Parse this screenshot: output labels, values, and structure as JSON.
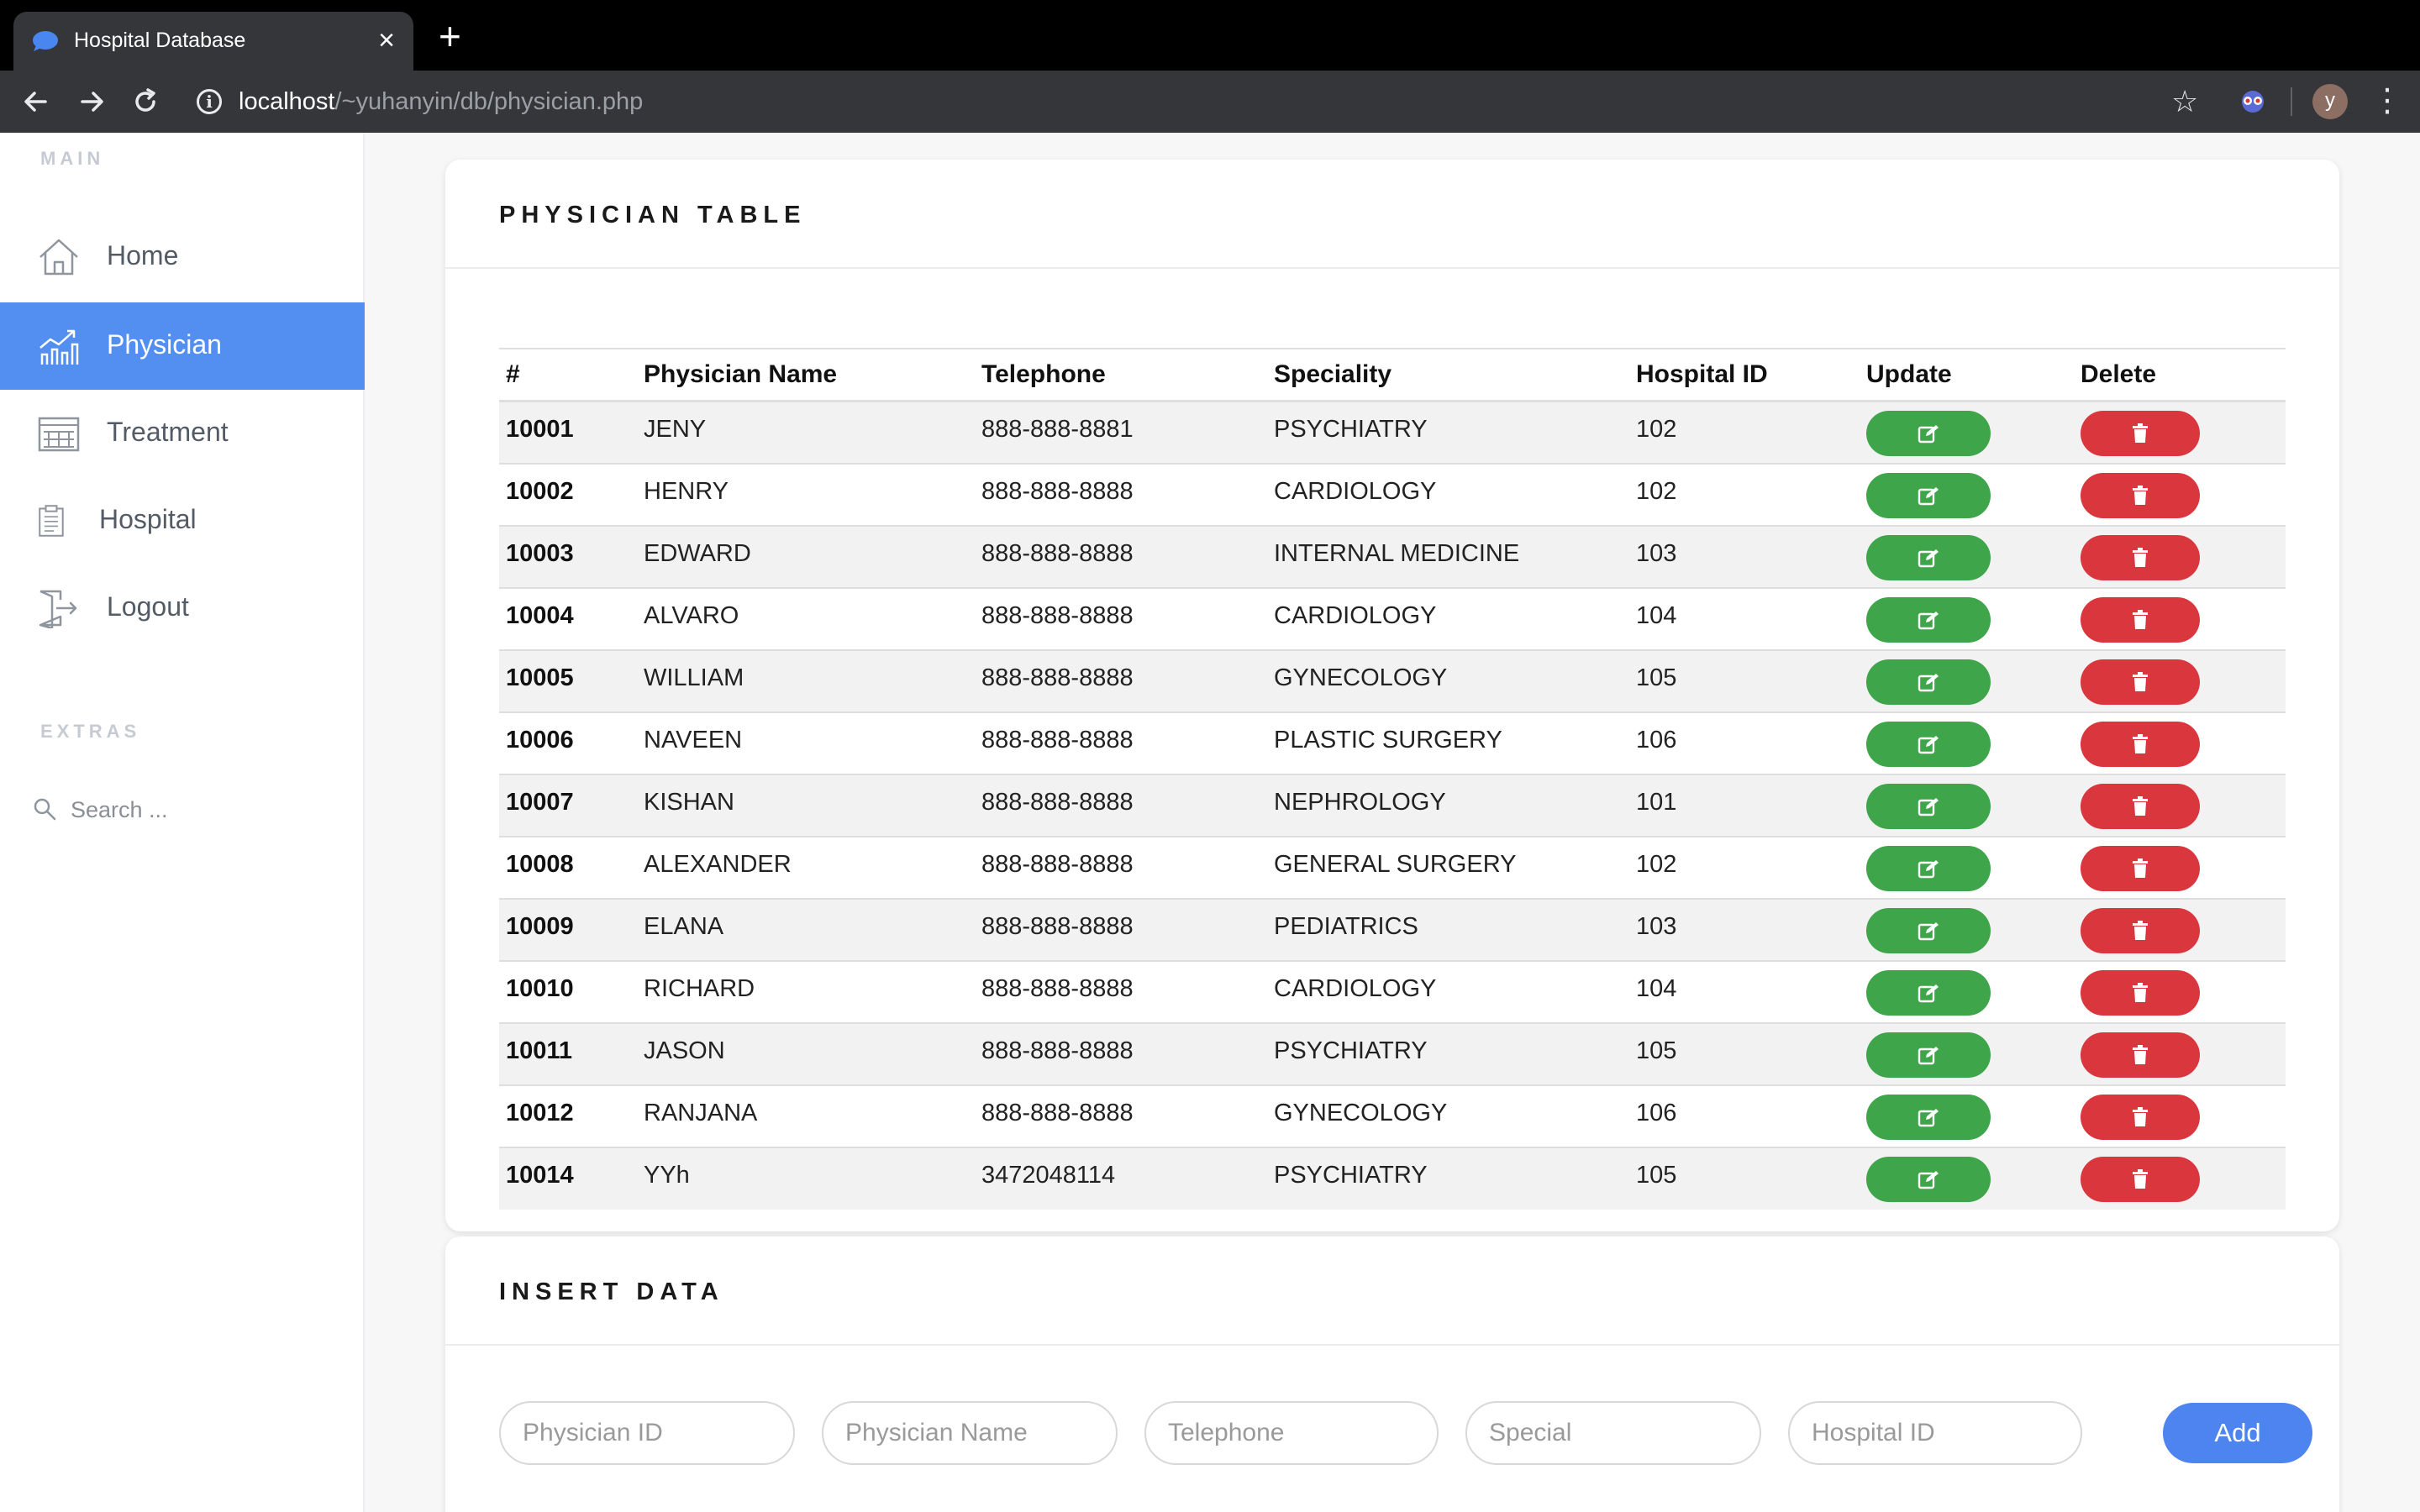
{
  "browser": {
    "tab_title": "Hospital Database",
    "url_host": "localhost",
    "url_path": "/~yuhanyin/db/physician.php",
    "avatar_letter": "y"
  },
  "sidebar": {
    "main_label": "MAIN",
    "extras_label": "EXTRAS",
    "items": [
      {
        "label": "Home",
        "icon": "home-icon"
      },
      {
        "label": "Physician",
        "icon": "chart-icon",
        "active": true
      },
      {
        "label": "Treatment",
        "icon": "calendar-icon"
      },
      {
        "label": "Hospital",
        "icon": "clipboard-icon"
      },
      {
        "label": "Logout",
        "icon": "logout-icon"
      }
    ],
    "search_placeholder": "Search ..."
  },
  "physician_table": {
    "title": "PHYSICIAN TABLE",
    "columns": [
      "#",
      "Physician Name",
      "Telephone",
      "Speciality",
      "Hospital ID",
      "Update",
      "Delete"
    ],
    "rows": [
      {
        "id": "10001",
        "name": "JENY",
        "telephone": "888-888-8881",
        "speciality": "PSYCHIATRY",
        "hospital_id": "102"
      },
      {
        "id": "10002",
        "name": "HENRY",
        "telephone": "888-888-8888",
        "speciality": "CARDIOLOGY",
        "hospital_id": "102"
      },
      {
        "id": "10003",
        "name": "EDWARD",
        "telephone": "888-888-8888",
        "speciality": "INTERNAL MEDICINE",
        "hospital_id": "103"
      },
      {
        "id": "10004",
        "name": "ALVARO",
        "telephone": "888-888-8888",
        "speciality": "CARDIOLOGY",
        "hospital_id": "104"
      },
      {
        "id": "10005",
        "name": "WILLIAM",
        "telephone": "888-888-8888",
        "speciality": "GYNECOLOGY",
        "hospital_id": "105"
      },
      {
        "id": "10006",
        "name": "NAVEEN",
        "telephone": "888-888-8888",
        "speciality": "PLASTIC SURGERY",
        "hospital_id": "106"
      },
      {
        "id": "10007",
        "name": "KISHAN",
        "telephone": "888-888-8888",
        "speciality": "NEPHROLOGY",
        "hospital_id": "101"
      },
      {
        "id": "10008",
        "name": "ALEXANDER",
        "telephone": "888-888-8888",
        "speciality": "GENERAL SURGERY",
        "hospital_id": "102"
      },
      {
        "id": "10009",
        "name": "ELANA",
        "telephone": "888-888-8888",
        "speciality": "PEDIATRICS",
        "hospital_id": "103"
      },
      {
        "id": "10010",
        "name": "RICHARD",
        "telephone": "888-888-8888",
        "speciality": "CARDIOLOGY",
        "hospital_id": "104"
      },
      {
        "id": "10011",
        "name": "JASON",
        "telephone": "888-888-8888",
        "speciality": "PSYCHIATRY",
        "hospital_id": "105"
      },
      {
        "id": "10012",
        "name": "RANJANA",
        "telephone": "888-888-8888",
        "speciality": "GYNECOLOGY",
        "hospital_id": "106"
      },
      {
        "id": "10014",
        "name": "YYh",
        "telephone": "3472048114",
        "speciality": "PSYCHIATRY",
        "hospital_id": "105"
      }
    ],
    "update_icon": "edit-icon",
    "delete_icon": "trash-icon"
  },
  "insert_form": {
    "title": "INSERT DATA",
    "placeholders": {
      "physician_id": "Physician ID",
      "physician_name": "Physician Name",
      "telephone": "Telephone",
      "special": "Special",
      "hospital_id": "Hospital ID"
    },
    "add_label": "Add"
  },
  "colors": {
    "accent": "#528ff0",
    "update_button": "#3ea54a",
    "delete_button": "#d9363e",
    "add_button": "#4d84f0"
  }
}
